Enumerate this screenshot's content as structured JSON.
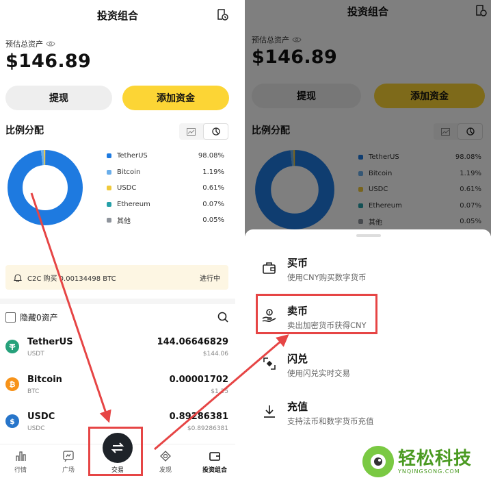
{
  "header": {
    "title": "投资组合"
  },
  "balance": {
    "label": "预估总资产",
    "amount": "$146.89"
  },
  "actions": {
    "withdraw": "提现",
    "deposit": "添加资金"
  },
  "allocation": {
    "title": "比例分配",
    "items": [
      {
        "name": "TetherUS",
        "pct": "98.08%",
        "value": 98.08,
        "color": "#1e7ae0"
      },
      {
        "name": "Bitcoin",
        "pct": "1.19%",
        "value": 1.19,
        "color": "#6aaeea"
      },
      {
        "name": "USDC",
        "pct": "0.61%",
        "value": 0.61,
        "color": "#f0c93a"
      },
      {
        "name": "Ethereum",
        "pct": "0.07%",
        "value": 0.07,
        "color": "#26a0a8"
      },
      {
        "name": "其他",
        "pct": "0.05%",
        "value": 0.05,
        "color": "#8f949c"
      }
    ]
  },
  "banner": {
    "text": "C2C 购买 0.00134498 BTC",
    "status": "进行中"
  },
  "assets_header": {
    "hide_zero": "隐藏0资产"
  },
  "assets": [
    {
      "name": "TetherUS",
      "symbol": "USDT",
      "qty": "144.06646829",
      "usd": "$144.06",
      "color": "#26a17b"
    },
    {
      "name": "Bitcoin",
      "symbol": "BTC",
      "qty": "0.00001702",
      "usd": "$1.25",
      "color": "#f7931a"
    },
    {
      "name": "USDC",
      "symbol": "USDC",
      "qty": "0.89286381",
      "usd": "$0.89286381",
      "color": "#2775ca"
    }
  ],
  "nav": {
    "market": "行情",
    "square": "广场",
    "trade": "交易",
    "discover": "发现",
    "portfolio": "投资组合"
  },
  "sheet": {
    "options": [
      {
        "title": "买币",
        "subtitle": "使用CNY购买数字货币"
      },
      {
        "title": "卖币",
        "subtitle": "卖出加密货币获得CNY"
      },
      {
        "title": "闪兑",
        "subtitle": "使用闪兑实时交易"
      },
      {
        "title": "充值",
        "subtitle": "支持法币和数字货币充值"
      }
    ]
  },
  "watermark": {
    "title": "轻松科技",
    "subtitle": "YNQINGSONG.COM"
  },
  "colors": {
    "yellow": "#fcd535",
    "highlight": "#e64545"
  }
}
